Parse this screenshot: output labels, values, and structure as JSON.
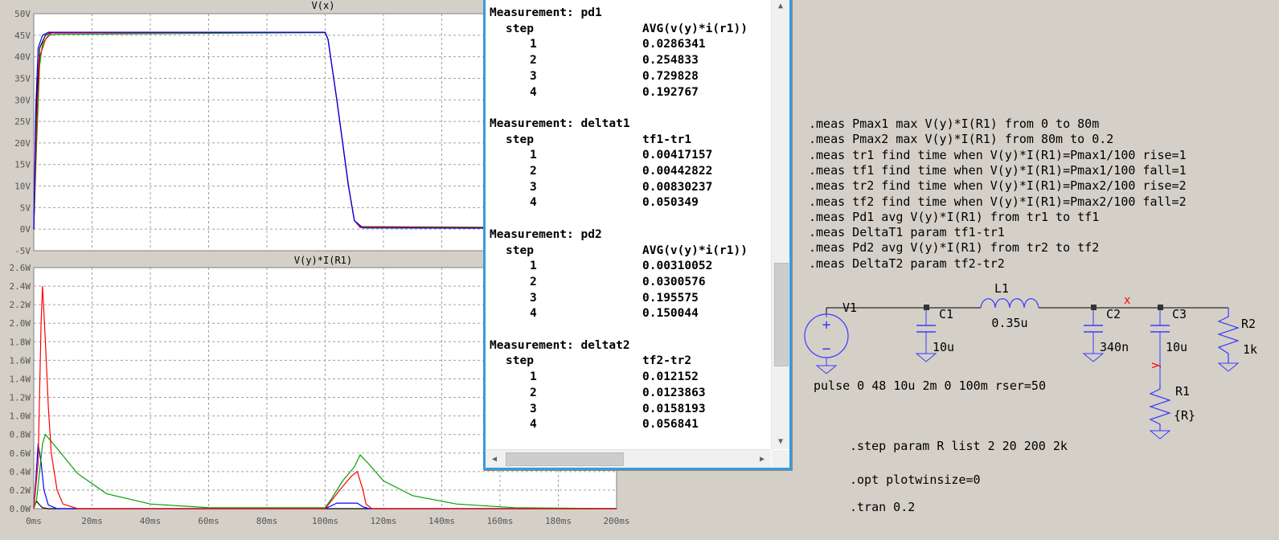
{
  "plots": {
    "top": {
      "title": "V(x)",
      "y_ticks": [
        "50V",
        "45V",
        "40V",
        "35V",
        "30V",
        "25V",
        "20V",
        "15V",
        "10V",
        "5V",
        "0V",
        "-5V"
      ]
    },
    "bottom": {
      "title": "V(y)*I(R1)",
      "y_ticks": [
        "2.6W",
        "2.4W",
        "2.2W",
        "2.0W",
        "1.8W",
        "1.6W",
        "1.4W",
        "1.2W",
        "1.0W",
        "0.8W",
        "0.6W",
        "0.4W",
        "0.2W",
        "0.0W"
      ]
    },
    "x_ticks": [
      "0ms",
      "20ms",
      "40ms",
      "60ms",
      "80ms",
      "100ms",
      "120ms",
      "140ms",
      "160ms",
      "180ms",
      "200ms"
    ],
    "trace_colors": [
      "#00a000",
      "#ff0000",
      "#0000ff",
      "#000000"
    ]
  },
  "measurements": [
    {
      "header": "Measurement: pd1",
      "col1": "step",
      "col2": "AVG(v(y)*i(r1))",
      "rows": [
        [
          "1",
          "0.0286341"
        ],
        [
          "2",
          "0.254833"
        ],
        [
          "3",
          "0.729828"
        ],
        [
          "4",
          "0.192767"
        ]
      ]
    },
    {
      "header": "Measurement: deltat1",
      "col1": "step",
      "col2": "tf1-tr1",
      "rows": [
        [
          "1",
          "0.00417157"
        ],
        [
          "2",
          "0.00442822"
        ],
        [
          "3",
          "0.00830237"
        ],
        [
          "4",
          "0.050349"
        ]
      ]
    },
    {
      "header": "Measurement: pd2",
      "col1": "step",
      "col2": "AVG(v(y)*i(r1))",
      "rows": [
        [
          "1",
          "0.00310052"
        ],
        [
          "2",
          "0.0300576"
        ],
        [
          "3",
          "0.195575"
        ],
        [
          "4",
          "0.150044"
        ]
      ]
    },
    {
      "header": "Measurement: deltat2",
      "col1": "step",
      "col2": "tf2-tr2",
      "rows": [
        [
          "1",
          "0.012152"
        ],
        [
          "2",
          "0.0123863"
        ],
        [
          "3",
          "0.0158193"
        ],
        [
          "4",
          "0.056841"
        ]
      ]
    }
  ],
  "schematic": {
    "meas_directives": [
      ".meas Pmax1 max V(y)*I(R1) from 0 to 80m",
      ".meas Pmax2 max V(y)*I(R1) from 80m to 0.2",
      ".meas tr1 find time when V(y)*I(R1)=Pmax1/100 rise=1",
      ".meas tf1 find time when V(y)*I(R1)=Pmax1/100 fall=1",
      ".meas tr2 find time when V(y)*I(R1)=Pmax2/100 rise=2",
      ".meas tf2 find time when V(y)*I(R1)=Pmax2/100 fall=2",
      ".meas Pd1 avg V(y)*I(R1) from tr1 to tf1",
      ".meas DeltaT1 param tf1-tr1",
      ".meas Pd2 avg V(y)*I(R1) from tr2 to tf2",
      ".meas DeltaT2 param tf2-tr2"
    ],
    "source_label": "V1",
    "source_value": "pulse 0 48 10u 2m 0 100m rser=50",
    "c1_label": "C1",
    "c1_value": "10u",
    "l1_label": "L1",
    "l1_value": "0.35u",
    "c2_label": "C2",
    "c2_value": "340n",
    "c3_label": "C3",
    "c3_value": "10u",
    "r2_label": "R2",
    "r2_value": "1k",
    "r1_label": "R1",
    "r1_value": "{R}",
    "net_x": "x",
    "net_y": "y",
    "step_directive": ".step param R list 2 20 200 2k",
    "opt_directive": ".opt plotwinsize=0",
    "tran_directive": ".tran 0.2"
  }
}
